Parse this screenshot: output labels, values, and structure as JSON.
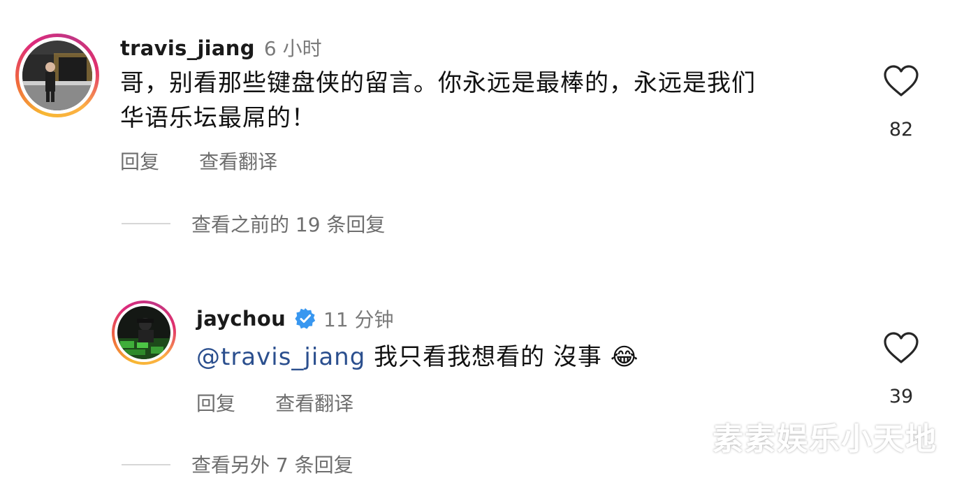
{
  "comments": [
    {
      "username": "travis_jiang",
      "time": "6 小时",
      "text_line1": "哥，别看那些键盘侠的留言。你永远是最棒的，永远是我们",
      "text_line2": "华语乐坛最屌的！",
      "reply_label": "回复",
      "translate_label": "查看翻译",
      "likes": "82",
      "avatar_icon": "avatar-photo"
    },
    {
      "username": "jaychou",
      "time": "11 分钟",
      "mention": "@travis_jiang",
      "text": " 我只看我想看的 沒事",
      "emoji": "😂",
      "reply_label": "回复",
      "translate_label": "查看翻译",
      "likes": "39",
      "verified_icon": "verified-badge-icon",
      "avatar_icon": "avatar-photo"
    }
  ],
  "view_previous_replies": "查看之前的 19 条回复",
  "view_more_replies": "查看另外 7 条回复",
  "watermark": "素素娱乐小天地",
  "colors": {
    "mention": "#2b4f8e",
    "verified": "#3897f0",
    "secondary_text": "#6e6e6e"
  }
}
